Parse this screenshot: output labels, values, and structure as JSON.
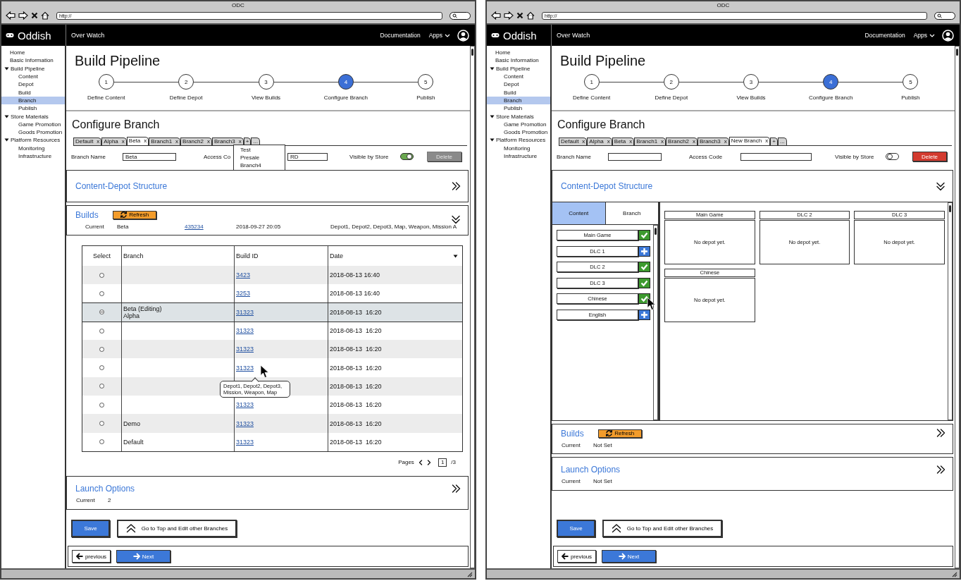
{
  "windows": [
    {
      "title": "ODC",
      "url": "http://",
      "brand": "Oddish",
      "app_name": "Over Watch",
      "nav_links": [
        "Documentation"
      ],
      "apps_menu": "Apps",
      "sidebar": [
        {
          "label": "Home",
          "selected": false
        },
        {
          "label": "Basic Information",
          "selected": false
        },
        {
          "label": "Build Pipeline",
          "selected": false,
          "expanded": true,
          "children": [
            {
              "label": "Content",
              "selected": false
            },
            {
              "label": "Depot",
              "selected": false
            },
            {
              "label": "Build",
              "selected": false
            },
            {
              "label": "Branch",
              "selected": true
            },
            {
              "label": "Publish",
              "selected": false
            }
          ]
        },
        {
          "label": "Store Materials",
          "selected": false,
          "expanded": true,
          "children": [
            {
              "label": "Game Promotion",
              "selected": false
            },
            {
              "label": "Goods Promotion",
              "selected": false
            }
          ]
        },
        {
          "label": "Platform Resources",
          "selected": false,
          "expanded": true,
          "children": [
            {
              "label": "Monitoring",
              "selected": false
            },
            {
              "label": "Infrastructure",
              "selected": false
            }
          ]
        }
      ],
      "page_title": "Build Pipeline",
      "steps": [
        {
          "number": "1",
          "label": "Define Content",
          "selected": false
        },
        {
          "number": "2",
          "label": "Define Depot",
          "selected": false
        },
        {
          "number": "3",
          "label": "View Builds",
          "selected": false
        },
        {
          "number": "4",
          "label": "Configure Branch",
          "selected": true
        },
        {
          "number": "5",
          "label": "Publish",
          "selected": false
        }
      ],
      "section_title": "Configure Branch",
      "branch_tabs": [
        {
          "label": "Default",
          "close": "x",
          "selected": false
        },
        {
          "label": "Alpha",
          "close": "x",
          "selected": false
        },
        {
          "label": "Beta",
          "close": "x",
          "selected": true
        },
        {
          "label": "Branch1",
          "close": "x",
          "selected": false
        },
        {
          "label": "Branch2",
          "close": "x",
          "selected": false
        },
        {
          "label": "Branch3",
          "close": "x",
          "selected": false
        },
        {
          "label": "+",
          "selected": false
        },
        {
          "label": "...",
          "selected": false
        }
      ],
      "tab_menu": [
        "Test",
        "Presale",
        "Branch4"
      ],
      "form": {
        "fields": [
          {
            "label": "Branch Name",
            "value": "Beta"
          },
          {
            "label": "Access Co",
            "value": "RD"
          }
        ],
        "visible_label": "Visible by Store",
        "visible": true,
        "delete": {
          "label": "Delete",
          "disabled": true
        }
      },
      "sections": [
        {
          "kind": "content_depot",
          "title": "Content-Depot Structure",
          "expanded": false
        },
        {
          "kind": "builds",
          "title": "Builds",
          "refresh": "Refresh",
          "expanded": true,
          "current_label": "Current",
          "current": [
            {
              "text": "Beta",
              "link": false
            },
            {
              "text": "435234",
              "link": true
            },
            {
              "text": "2018-09-27 20:05",
              "link": false
            },
            {
              "text": "Depot1, Depot2, Depot3, Map, Weapon, Mission A",
              "link": false
            }
          ],
          "table": {
            "columns": [
              "Select",
              "Branch",
              "Build ID",
              "Date"
            ],
            "rows": [
              {
                "selected": false,
                "hovered": false,
                "build_id": "3423",
                "date": "2018-08-13 16:40"
              },
              {
                "selected": false,
                "hovered": false,
                "build_id": "3253",
                "date": "2018-08-13 16:40"
              },
              {
                "selected": true,
                "hovered": false,
                "branch": [
                  "Beta (Editing)",
                  "Alpha"
                ],
                "build_id": "31323",
                "date": "2018-08-13  16:20"
              },
              {
                "selected": false,
                "hovered": false,
                "build_id": "31323",
                "date": "2018-08-13  16:20"
              },
              {
                "selected": false,
                "hovered": false,
                "build_id": "31323",
                "date": "2018-08-13  16:20"
              },
              {
                "selected": false,
                "hovered": true,
                "build_id": "31323",
                "date": "2018-08-13  16:20",
                "tooltip": "Depot1, Depot2, Depot3,\nMission, Weapon, Map"
              },
              {
                "selected": false,
                "hovered": false,
                "date": "2018-08-13  16:20"
              },
              {
                "selected": false,
                "hovered": false,
                "build_id": "31323",
                "date": "2018-08-13  16:20"
              },
              {
                "selected": false,
                "hovered": false,
                "branch": [
                  "Demo"
                ],
                "build_id": "31323",
                "date": "2018-08-13  16:20"
              },
              {
                "selected": false,
                "hovered": false,
                "branch": [
                  "Default"
                ],
                "build_id": "31323",
                "date": "2018-08-13  16:20"
              }
            ],
            "pager": {
              "label": "Pages",
              "page": "1",
              "total": "/3"
            }
          }
        },
        {
          "kind": "launch",
          "title": "Launch Options",
          "expanded": false,
          "current_label": "Current",
          "current": [
            {
              "text": "2",
              "link": false
            }
          ]
        }
      ],
      "actions": [
        {
          "label": "Save",
          "kind": "primary"
        },
        {
          "label": "Go to Top and Edit other Branches",
          "kind": "top"
        }
      ],
      "nav_buttons": [
        {
          "label": "previous",
          "kind": "back"
        },
        {
          "label": "Next",
          "kind": "next"
        }
      ]
    },
    {
      "title": "ODC",
      "url": "http://",
      "brand": "Oddish",
      "app_name": "Over Watch",
      "nav_links": [
        "Documentation"
      ],
      "apps_menu": "Apps",
      "sidebar": [
        {
          "label": "Home",
          "selected": false
        },
        {
          "label": "Basic Information",
          "selected": false
        },
        {
          "label": "Build Pipeline",
          "selected": false,
          "expanded": true,
          "children": [
            {
              "label": "Content",
              "selected": false
            },
            {
              "label": "Depot",
              "selected": false
            },
            {
              "label": "Build",
              "selected": false
            },
            {
              "label": "Branch",
              "selected": true
            },
            {
              "label": "Publish",
              "selected": false
            }
          ]
        },
        {
          "label": "Store Materials",
          "selected": false,
          "expanded": true,
          "children": [
            {
              "label": "Game Promotion",
              "selected": false
            },
            {
              "label": "Goods Promotion",
              "selected": false
            }
          ]
        },
        {
          "label": "Platform Resources",
          "selected": false,
          "expanded": true,
          "children": [
            {
              "label": "Monitoring",
              "selected": false
            },
            {
              "label": "Infrastructure",
              "selected": false
            }
          ]
        }
      ],
      "page_title": "Build Pipeline",
      "steps": [
        {
          "number": "1",
          "label": "Define Content",
          "selected": false
        },
        {
          "number": "2",
          "label": "Define Depot",
          "selected": false
        },
        {
          "number": "3",
          "label": "View Builds",
          "selected": false
        },
        {
          "number": "4",
          "label": "Configure Branch",
          "selected": true
        },
        {
          "number": "5",
          "label": "Publish",
          "selected": false
        }
      ],
      "section_title": "Configure Branch",
      "branch_tabs": [
        {
          "label": "Default",
          "close": "x",
          "selected": false
        },
        {
          "label": "Alpha",
          "close": "x",
          "selected": false
        },
        {
          "label": "Beta",
          "close": "x",
          "selected": false
        },
        {
          "label": "Branch1",
          "close": "x",
          "selected": false
        },
        {
          "label": "Branch2",
          "close": "x",
          "selected": false
        },
        {
          "label": "Branch3",
          "close": "x",
          "selected": false
        },
        {
          "label": "New Branch",
          "close": "x",
          "selected": true
        },
        {
          "label": "+",
          "selected": false
        },
        {
          "label": "...",
          "selected": false
        }
      ],
      "form": {
        "fields": [
          {
            "label": "Branch Name"
          },
          {
            "label": "Access Code"
          }
        ],
        "visible_label": "Visible by Store",
        "visible": false,
        "delete": {
          "label": "Delete",
          "disabled": false
        }
      },
      "sections": [
        {
          "kind": "content_depot",
          "title": "Content-Depot Structure",
          "expanded": true,
          "tabs": [
            {
              "label": "Content",
              "selected": true
            },
            {
              "label": "Branch",
              "selected": false
            }
          ],
          "items": [
            {
              "label": "Main Game",
              "kind": "added",
              "hovered": false
            },
            {
              "label": "DLC 1",
              "kind": "available",
              "hovered": false
            },
            {
              "label": "DLC 2",
              "kind": "added",
              "hovered": false
            },
            {
              "label": "DLC 3",
              "kind": "added",
              "hovered": false
            },
            {
              "label": "Chinese",
              "kind": "added",
              "hovered": true
            },
            {
              "label": "English",
              "kind": "available",
              "hovered": false
            }
          ],
          "depots": [
            {
              "title": "Main Game",
              "text": "No depot yet."
            },
            {
              "title": "DLC 2",
              "text": "No depot yet."
            },
            {
              "title": "DLC 3",
              "text": "No depot yet."
            },
            {
              "title": "Chinese",
              "text": "No depot yet."
            }
          ]
        },
        {
          "kind": "builds",
          "title": "Builds",
          "refresh": "Refresh",
          "expanded": false,
          "current_label": "Current",
          "current": [
            {
              "text": "Not Set",
              "link": false
            }
          ]
        },
        {
          "kind": "launch",
          "title": "Launch Options",
          "expanded": false,
          "current_label": "Current",
          "current": [
            {
              "text": "Not Set",
              "link": false
            }
          ]
        }
      ],
      "actions": [
        {
          "label": "Save",
          "kind": "primary"
        },
        {
          "label": "Go to Top and Edit other Branches",
          "kind": "top"
        }
      ],
      "nav_buttons": [
        {
          "label": "previous",
          "kind": "back"
        },
        {
          "label": "Next",
          "kind": "next"
        }
      ]
    }
  ]
}
